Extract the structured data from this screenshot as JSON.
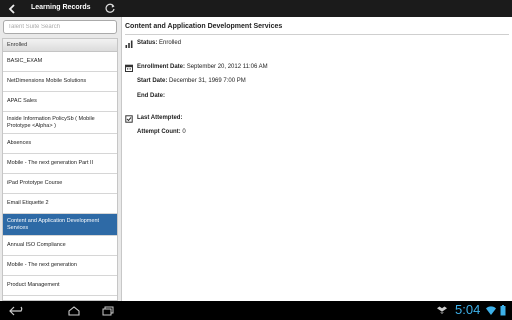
{
  "header": {
    "title": "Learning Records",
    "back_icon": "back-arrow-icon",
    "refresh_icon": "refresh-icon"
  },
  "search": {
    "placeholder": "Talent Suite Search",
    "value": ""
  },
  "list": {
    "section": "Enrolled",
    "items": [
      {
        "label": "BASIC_EXAM"
      },
      {
        "label": "NetDimensions Mobile Solutions"
      },
      {
        "label": "APAC Sales"
      },
      {
        "label": "Inside Information PolicySb ( Mobile Prototype <Alpha> )"
      },
      {
        "label": "Absences"
      },
      {
        "label": "Mobile - The next generation Part II"
      },
      {
        "label": "iPad Prototype Course"
      },
      {
        "label": "Email Etiquette 2"
      },
      {
        "label": "Content and Application Development Services",
        "selected": true
      },
      {
        "label": "Annual ISO Compliance"
      },
      {
        "label": "Mobile - The next generation"
      },
      {
        "label": "Product Management"
      }
    ]
  },
  "detail": {
    "title": "Content and Application Development Services",
    "status_label": "Status:",
    "status_value": "Enrolled",
    "enrollment_label": "Enrollment Date:",
    "enrollment_value": "September 20, 2012 11:06 AM",
    "start_label": "Start Date:",
    "start_value": "December 31, 1969 7:00 PM",
    "end_label": "End Date:",
    "end_value": "",
    "last_label": "Last Attempted:",
    "last_value": "",
    "count_label": "Attempt Count:",
    "count_value": "0"
  },
  "system": {
    "time": "5:04"
  },
  "colors": {
    "selected": "#2e6aa6",
    "clock": "#3db0e8"
  }
}
